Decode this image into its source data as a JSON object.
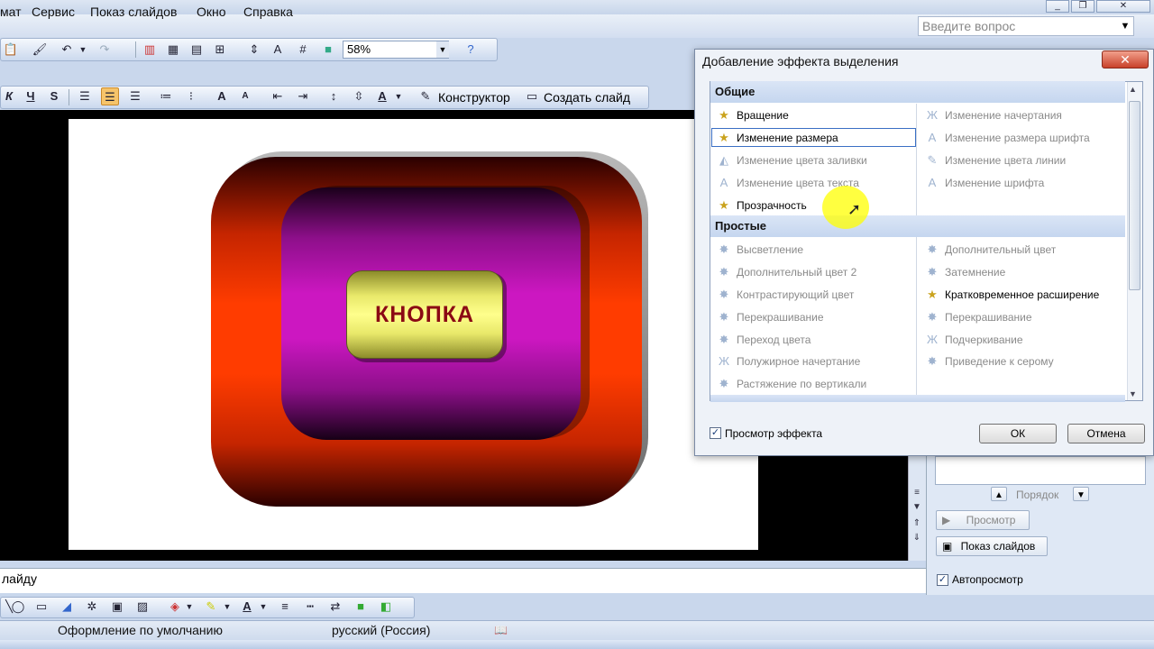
{
  "menubar": {
    "items": [
      "мат",
      "Сервис",
      "Показ слайдов",
      "Окно",
      "Справка"
    ],
    "ask_placeholder": "Введите вопрос"
  },
  "toolbar": {
    "zoom": "58%",
    "design_label": "Конструктор",
    "new_slide_label": "Создать слайд"
  },
  "slide": {
    "button_text": "КНОПКА"
  },
  "notes": {
    "text": "лайду"
  },
  "taskpane": {
    "order_label": "Порядок",
    "preview_label": "Просмотр",
    "slideshow_label": "Показ слайдов",
    "autopreview_label": "Автопросмотр",
    "autopreview_checked": true
  },
  "statusbar": {
    "design": "Оформление по умолчанию",
    "language": "русский (Россия)"
  },
  "dialog": {
    "title": "Добавление эффекта выделения",
    "close_label": "✕",
    "groups": [
      {
        "name": "Общие",
        "items": [
          {
            "label": "Вращение",
            "enabled": true
          },
          {
            "label": "Изменение начертания",
            "enabled": false
          },
          {
            "label": "Изменение размера",
            "enabled": true,
            "selected": true
          },
          {
            "label": "Изменение размера шрифта",
            "enabled": false
          },
          {
            "label": "Изменение цвета заливки",
            "enabled": false
          },
          {
            "label": "Изменение цвета линии",
            "enabled": false
          },
          {
            "label": "Изменение цвета текста",
            "enabled": false
          },
          {
            "label": "Изменение шрифта",
            "enabled": false
          },
          {
            "label": "Прозрачность",
            "enabled": true
          }
        ]
      },
      {
        "name": "Простые",
        "items": [
          {
            "label": "Высветление",
            "enabled": false
          },
          {
            "label": "Дополнительный цвет",
            "enabled": false
          },
          {
            "label": "Дополнительный цвет 2",
            "enabled": false
          },
          {
            "label": "Затемнение",
            "enabled": false
          },
          {
            "label": "Контрастирующий цвет",
            "enabled": false
          },
          {
            "label": "Кратковременное расширение",
            "enabled": true
          },
          {
            "label": "Перекрашивание",
            "enabled": false
          },
          {
            "label": "Перекрашивание",
            "enabled": false
          },
          {
            "label": "Переход цвета",
            "enabled": false
          },
          {
            "label": "Подчеркивание",
            "enabled": false
          },
          {
            "label": "Полужирное начертание",
            "enabled": false
          },
          {
            "label": "Приведение к серому",
            "enabled": false
          },
          {
            "label": "Растяжение по вертикали",
            "enabled": false
          }
        ]
      }
    ],
    "preview_effect_label": "Просмотр эффекта",
    "preview_effect_checked": true,
    "ok_label": "ОК",
    "cancel_label": "Отмена"
  },
  "colors": {
    "accent": "#3a6fc4",
    "group_header": "#c5d6ef",
    "button_text": "#8b0a14"
  }
}
